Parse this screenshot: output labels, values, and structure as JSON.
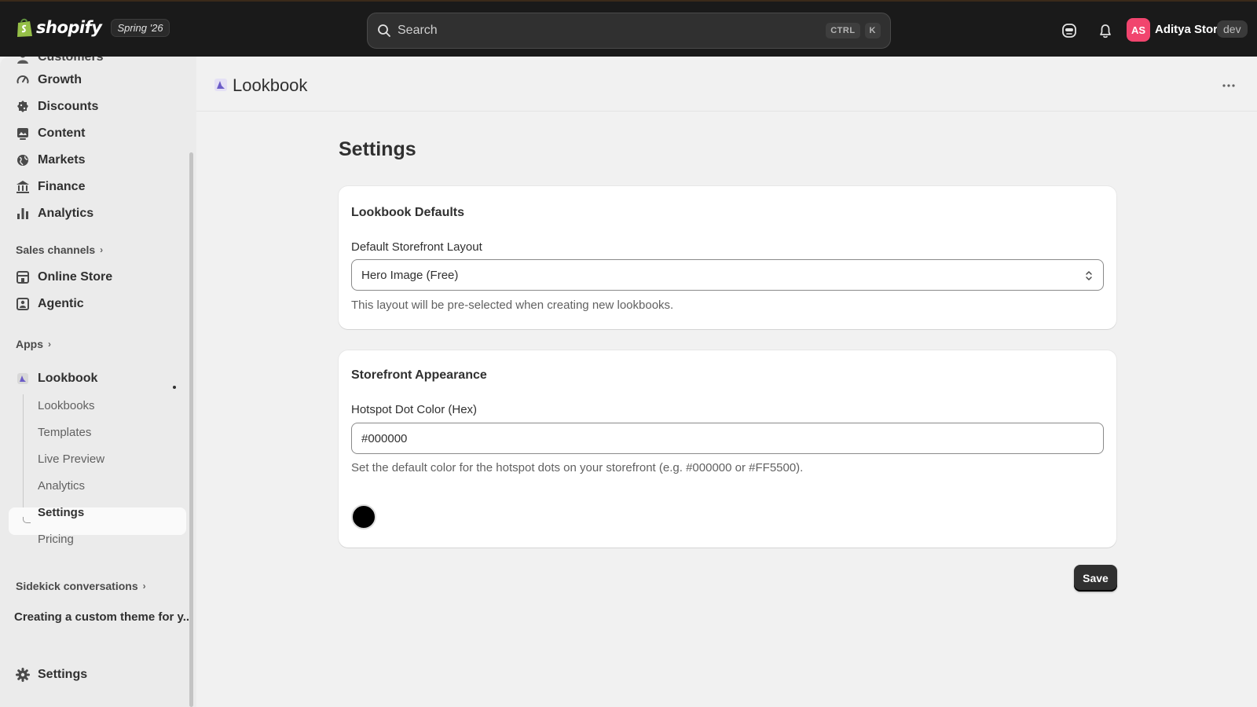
{
  "topbar": {
    "brand": "shopify",
    "edition": "Spring '26",
    "search_placeholder": "Search",
    "shortcut_keys": [
      "CTRL",
      "K"
    ],
    "avatar_initials": "AS",
    "store_name": "Aditya Store",
    "env_badge": "dev"
  },
  "sidebar": {
    "partial_top_item": "Customers",
    "items": [
      {
        "label": "Growth",
        "icon": "growth-icon"
      },
      {
        "label": "Discounts",
        "icon": "discount-icon"
      },
      {
        "label": "Content",
        "icon": "content-icon"
      },
      {
        "label": "Markets",
        "icon": "globe-icon"
      },
      {
        "label": "Finance",
        "icon": "bank-icon"
      },
      {
        "label": "Analytics",
        "icon": "bar-chart-icon"
      }
    ],
    "sales_channels_heading": "Sales channels",
    "channels": [
      {
        "label": "Online Store",
        "icon": "store-icon"
      },
      {
        "label": "Agentic",
        "icon": "agent-icon"
      }
    ],
    "apps_heading": "Apps",
    "app": {
      "label": "Lookbook",
      "subitems": [
        "Lookbooks",
        "Templates",
        "Live Preview",
        "Analytics",
        "Settings",
        "Pricing"
      ],
      "active": "Settings"
    },
    "sidekick_heading": "Sidekick conversations",
    "sidekick_item": "Creating a custom theme for y...",
    "settings_label": "Settings"
  },
  "page": {
    "app_title": "Lookbook",
    "title": "Settings"
  },
  "lookbook_defaults": {
    "title": "Lookbook Defaults",
    "layout_label": "Default Storefront Layout",
    "layout_value": "Hero Image (Free)",
    "layout_help": "This layout will be pre-selected when creating new lookbooks."
  },
  "storefront_appearance": {
    "title": "Storefront Appearance",
    "color_label": "Hotspot Dot Color (Hex)",
    "color_value": "#000000",
    "color_help": "Set the default color for the hotspot dots on your storefront (e.g. #000000 or #FF5500)."
  },
  "actions": {
    "save_label": "Save"
  },
  "colors": {
    "topbar_bg": "#1a1a1a",
    "avatar_bg": "#f1456e",
    "primary_button": "#303030",
    "hotspot_swatch": "#000000"
  }
}
